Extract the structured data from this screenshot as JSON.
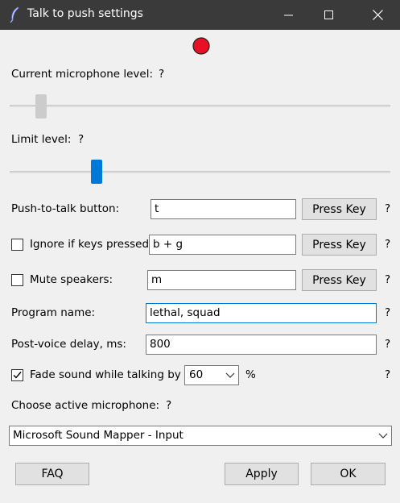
{
  "window": {
    "title": "Talk to push settings",
    "feather_icon": "feather-icon",
    "minimize_icon": "minimize-icon",
    "maximize_icon": "maximize-icon",
    "close_icon": "close-icon"
  },
  "status": {
    "indicator_color": "#e81123"
  },
  "mic_level": {
    "label": "Current microphone level:",
    "help": "?",
    "level": 0.07
  },
  "limit_level": {
    "label": "Limit level:",
    "help": "?",
    "level": 0.22
  },
  "push_to_talk": {
    "label": "Push-to-talk button:",
    "value": "t",
    "button": "Press Key",
    "help": "?"
  },
  "ignore_keys": {
    "label": "Ignore if keys pressed:",
    "checked": false,
    "value": "b + g",
    "button": "Press Key",
    "help": "?"
  },
  "mute_speakers": {
    "label": "Mute speakers:",
    "checked": false,
    "value": "m",
    "button": "Press Key",
    "help": "?"
  },
  "program_name": {
    "label": "Program name:",
    "value": "lethal, squad",
    "help": "?"
  },
  "post_voice_delay": {
    "label": "Post-voice delay, ms:",
    "value": "800",
    "help": "?"
  },
  "fade_sound": {
    "label": "Fade sound while talking by",
    "checked": true,
    "value": "60",
    "unit": "%",
    "help": "?"
  },
  "microphone": {
    "label": "Choose active microphone:",
    "help": "?",
    "selected": "Microsoft Sound Mapper - Input"
  },
  "footer": {
    "faq": "FAQ",
    "apply": "Apply",
    "ok": "OK"
  },
  "colors": {
    "accent": "#0078d7",
    "titlebar": "#3a3a3a",
    "background": "#f0f0f0"
  }
}
